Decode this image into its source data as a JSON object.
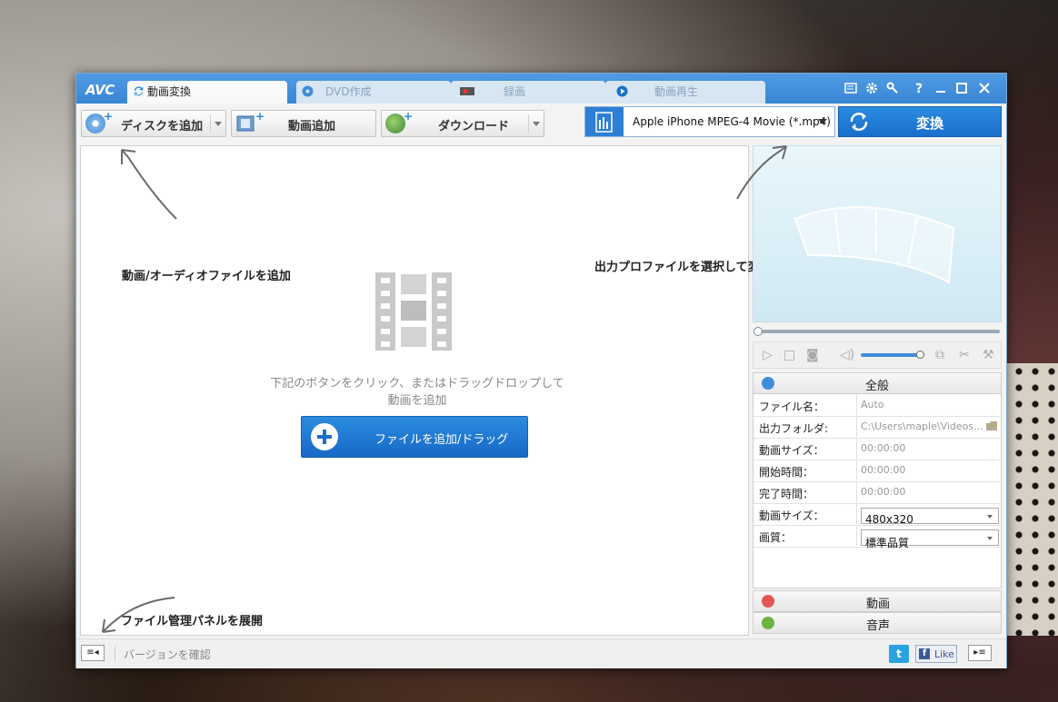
{
  "app": {
    "logo": "AVC"
  },
  "tabs": [
    {
      "label": "動画変換",
      "active": true
    },
    {
      "label": "DVD作成",
      "active": false
    },
    {
      "label": "録画",
      "active": false
    },
    {
      "label": "動画再生",
      "active": false
    }
  ],
  "window_controls": {
    "help": "?"
  },
  "toolbar": {
    "add_disc": "ディスクを追加",
    "add_video": "動画追加",
    "download": "ダウンロード",
    "profile": "Apple iPhone MPEG-4 Movie (*.mp4)",
    "convert": "変換"
  },
  "main": {
    "note_add_files": "動画/オーディオファイルを追加",
    "note_profile": "出力プロファイルを選択して変換",
    "note_panel": "ファイル管理パネルを展開",
    "hint": "下記のボタンをクリック、またはドラッグドロップして動画を追加",
    "add_button": "ファイルを追加/ドラッグ"
  },
  "properties": {
    "general_header": "全般",
    "rows": [
      {
        "key": "ファイル名：",
        "value": "Auto"
      },
      {
        "key": "出力フォルダ:",
        "value": "C:\\Users\\maple\\Videos..."
      },
      {
        "key": "動画サイズ：",
        "value": "00:00:00"
      },
      {
        "key": "開始時間：",
        "value": "00:00:00"
      },
      {
        "key": "完了時間：",
        "value": "00:00:00"
      },
      {
        "key": "動画サイズ：",
        "value": "480x320"
      },
      {
        "key": "画質：",
        "value": "標準品質"
      }
    ],
    "video_section": "動画",
    "audio_section": "音声"
  },
  "statusbar": {
    "version": "バージョンを確認",
    "twitter": "t",
    "fb_f": "f",
    "fb_like": "Like"
  },
  "colors": {
    "accent": "#2b8be0",
    "titlebar": "#4f9be3"
  }
}
